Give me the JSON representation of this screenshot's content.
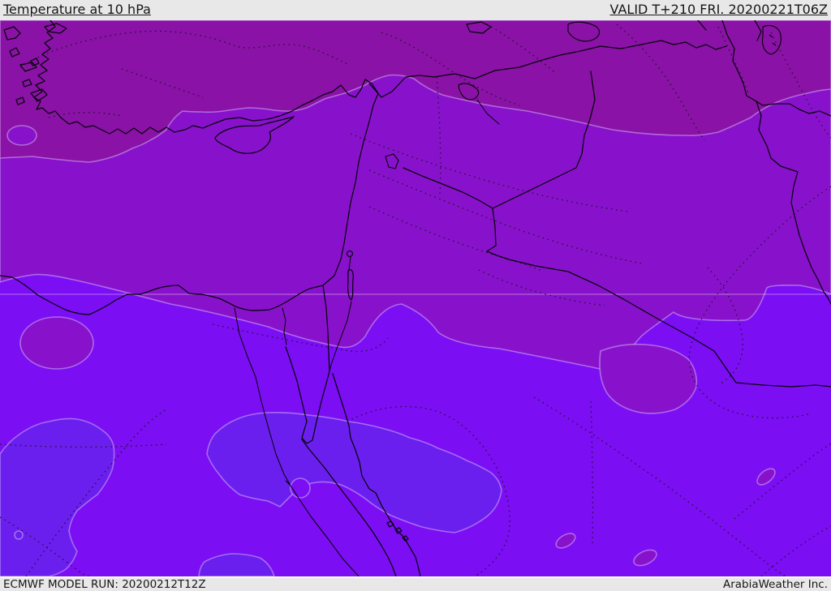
{
  "header": {
    "title": "Temperature at 10 hPa",
    "valid_label": "VALID T+210 FRI. 20200221T06Z"
  },
  "footer": {
    "model_run": "ECMWF MODEL RUN: 20200212T12Z",
    "attribution": "ArabiaWeather Inc."
  },
  "map": {
    "description": "Filled temperature contour map over the Eastern Mediterranean and Middle East with coastlines, country borders, dotted contour lines and a faint latitude line",
    "palette": {
      "band1": "#8a12a6",
      "band2": "#8812cb",
      "band3": "#7b0ef3",
      "band4": "#6b1fee",
      "contour_fringe": "#d9c0fa",
      "graticule": "#ffffff",
      "coastline": "#06040a",
      "dotted_contour": "#1c1024",
      "bar_bg": "#e8e8e8"
    }
  }
}
